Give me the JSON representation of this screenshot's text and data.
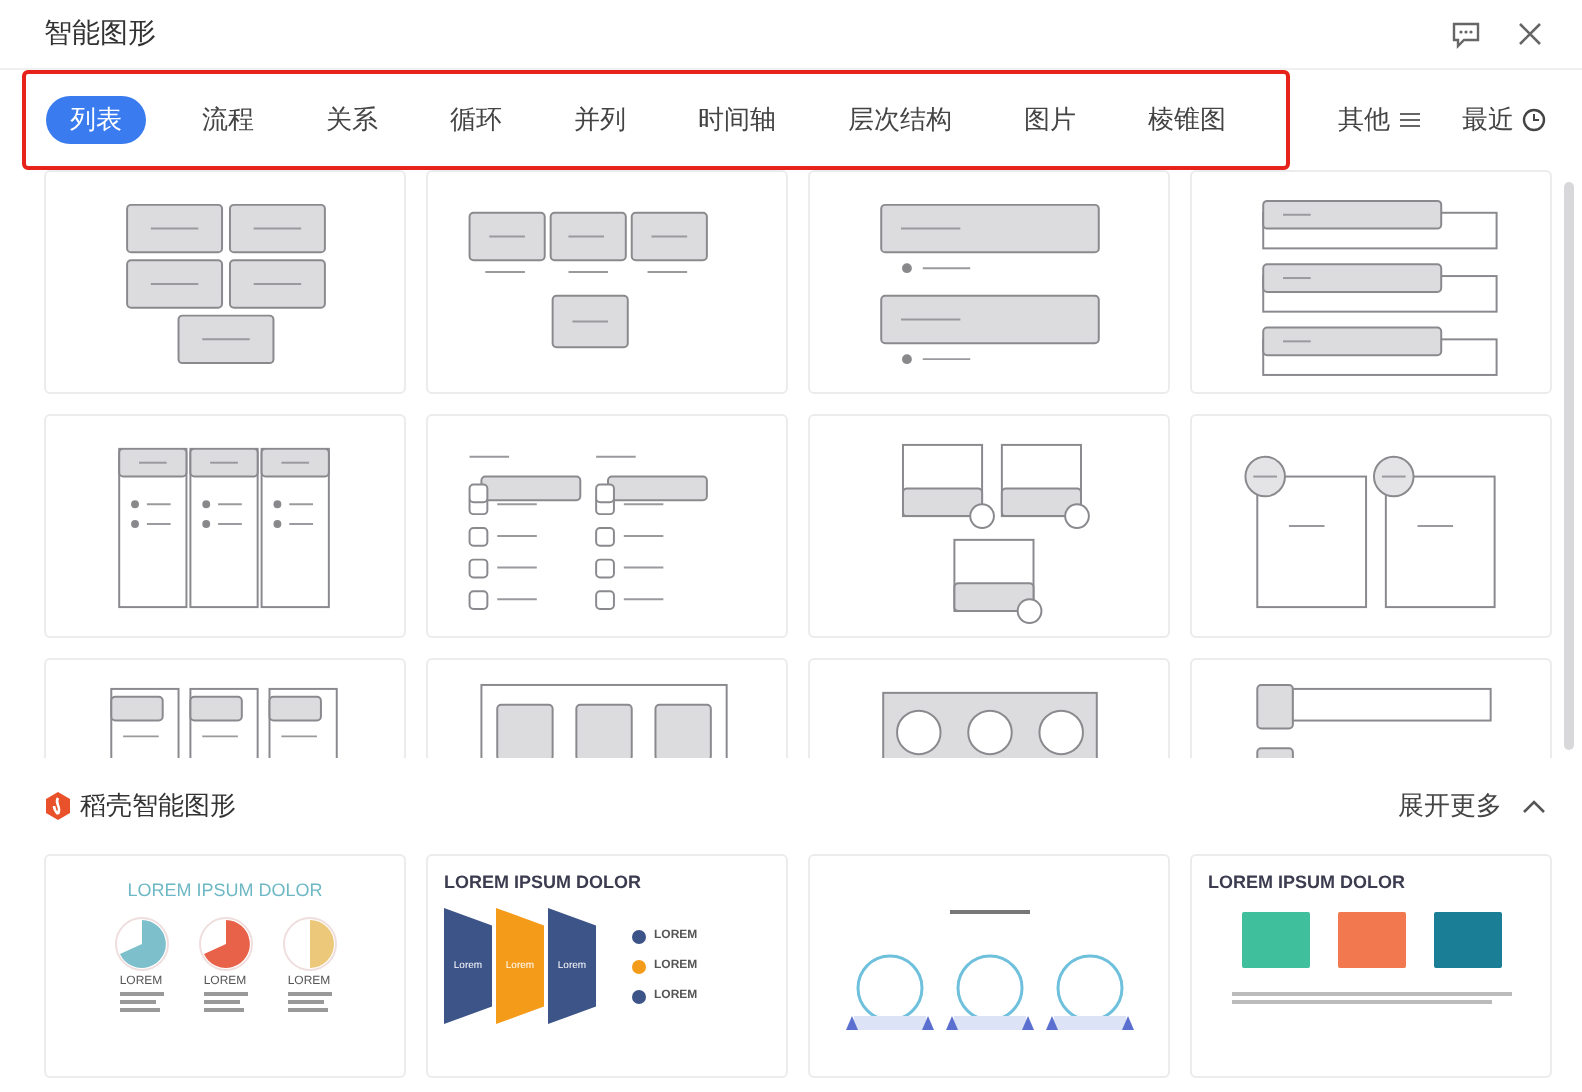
{
  "window": {
    "title": "智能图形"
  },
  "tabs": [
    {
      "label": "列表",
      "selected": true
    },
    {
      "label": "流程",
      "selected": false
    },
    {
      "label": "关系",
      "selected": false
    },
    {
      "label": "循环",
      "selected": false
    },
    {
      "label": "并列",
      "selected": false
    },
    {
      "label": "时间轴",
      "selected": false
    },
    {
      "label": "层次结构",
      "selected": false
    },
    {
      "label": "图片",
      "selected": false
    },
    {
      "label": "棱锥图",
      "selected": false
    }
  ],
  "filters": [
    {
      "label": "其他",
      "kind": "menu"
    },
    {
      "label": "最近",
      "kind": "clock"
    }
  ],
  "section": {
    "title": "稻壳智能图形",
    "expand_label": "展开更多",
    "expanded": true
  },
  "templates": [
    {
      "kind": "pie",
      "title": "LOREM IPSUM DOLOR",
      "items": [
        {
          "label": "LOREM",
          "color": "#7ebfcc"
        },
        {
          "label": "LOREM",
          "color": "#e8624a"
        },
        {
          "label": "LOREM",
          "color": "#ecc87a"
        }
      ]
    },
    {
      "kind": "chevron",
      "title": "LOREM IPSUM DOLOR",
      "items": [
        {
          "label": "Lorem",
          "color": "#3c5488"
        },
        {
          "label": "Lorem",
          "color": "#f59b1a"
        },
        {
          "label": "Lorem",
          "color": "#3c5488"
        }
      ],
      "rows": [
        {
          "label": "LOREM",
          "color": "#3c5488"
        },
        {
          "label": "LOREM",
          "color": "#f59b1a"
        },
        {
          "label": "LOREM",
          "color": "#3c5488"
        }
      ]
    },
    {
      "kind": "circles"
    },
    {
      "kind": "callouts",
      "title": "LOREM IPSUM DOLOR",
      "items": [
        {
          "color": "#3fbf9c"
        },
        {
          "color": "#f2784f"
        },
        {
          "color": "#1a7f96"
        }
      ]
    }
  ]
}
